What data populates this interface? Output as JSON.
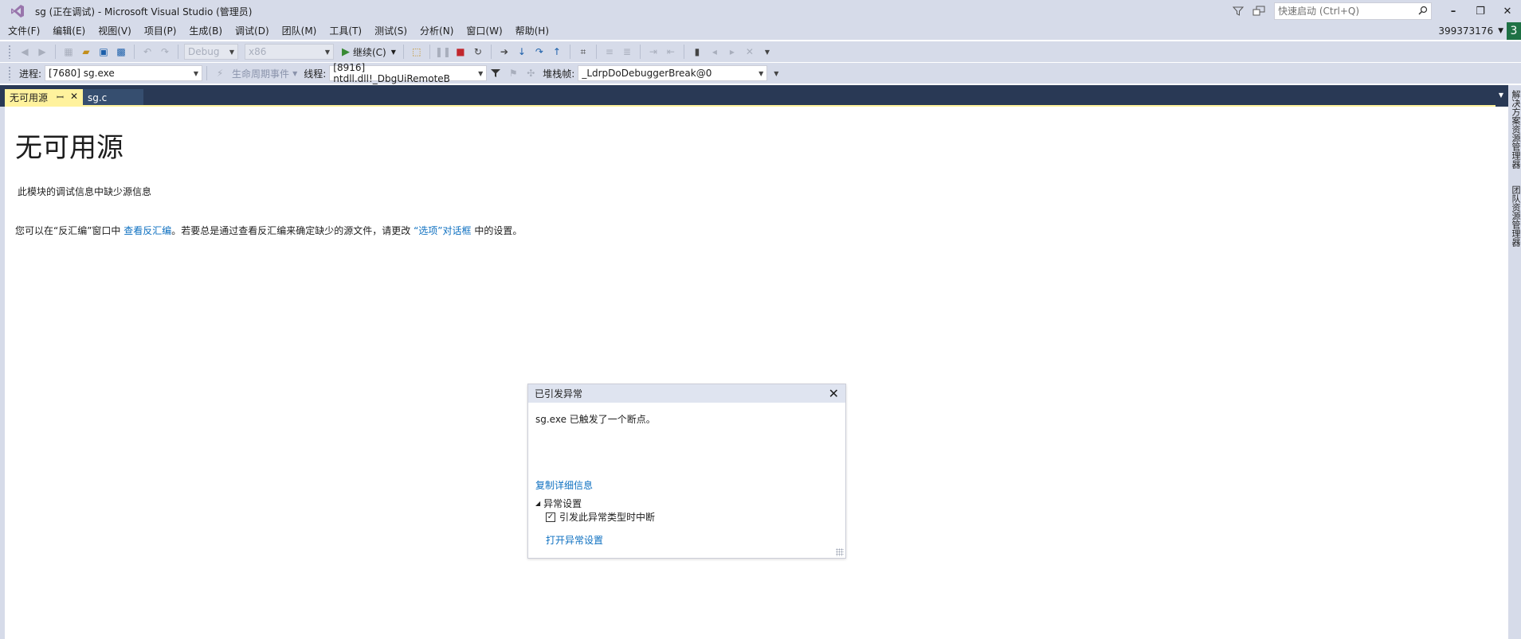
{
  "titlebar": {
    "title": "sg (正在调试) - Microsoft Visual Studio (管理员)",
    "quick_launch_placeholder": "快速启动 (Ctrl+Q)"
  },
  "menu": {
    "items": [
      "文件(F)",
      "编辑(E)",
      "视图(V)",
      "项目(P)",
      "生成(B)",
      "调试(D)",
      "团队(M)",
      "工具(T)",
      "测试(S)",
      "分析(N)",
      "窗口(W)",
      "帮助(H)"
    ],
    "user": "399373176",
    "notification_count": "3"
  },
  "toolbar1": {
    "config": "Debug",
    "platform": "x86",
    "continue_label": "继续(C)"
  },
  "toolbar2": {
    "process_label": "进程:",
    "process_value": "[7680] sg.exe",
    "lifecycle_label": "生命周期事件",
    "thread_label": "线程:",
    "thread_value": "[8916] ntdll.dll!_DbgUiRemoteB",
    "stackframe_label": "堆栈帧:",
    "stackframe_value": "_LdrpDoDebuggerBreak@0"
  },
  "tabs": {
    "active": "无可用源",
    "second": "sg.c"
  },
  "right_rail": {
    "tab1": "解决方案资源管理器",
    "tab2": "团队资源管理器"
  },
  "content": {
    "title": "无可用源",
    "missing_info": "此模块的调试信息中缺少源信息",
    "hint_pre": "您可以在“反汇编”窗口中 ",
    "hint_link1": "查看反汇编",
    "hint_mid": "。若要总是通过查看反汇编来确定缺少的源文件，请更改 ",
    "hint_link2": "“选项”对话框",
    "hint_post": " 中的设置。"
  },
  "exception": {
    "title": "已引发异常",
    "message": "sg.exe 已触发了一个断点。",
    "copy_details": "复制详细信息",
    "settings_header": "异常设置",
    "checkbox_label": "引发此异常类型时中断",
    "checkbox_checked": true,
    "open_settings": "打开异常设置"
  }
}
